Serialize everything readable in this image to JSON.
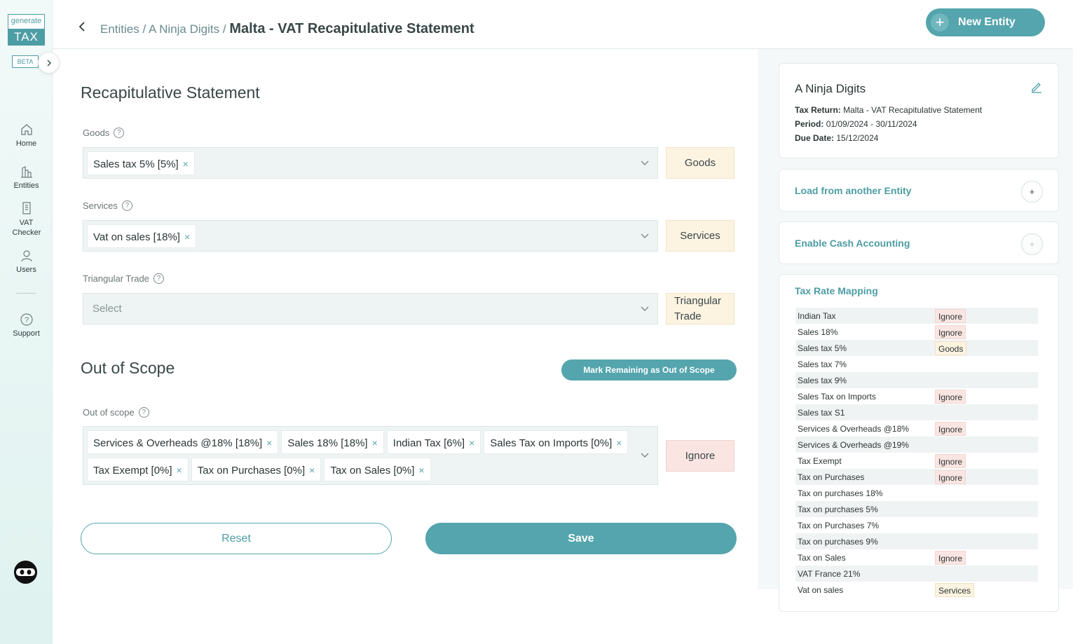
{
  "logo": {
    "top": "generate",
    "bottom": "TAX",
    "beta": "BETA"
  },
  "nav": [
    {
      "label": "Home",
      "icon": "home-icon"
    },
    {
      "label": "Entities",
      "icon": "building-icon"
    },
    {
      "label": "VAT Checker",
      "icon": "document-icon"
    },
    {
      "label": "Users",
      "icon": "user-icon"
    },
    {
      "label": "Support",
      "icon": "help-circle-icon"
    }
  ],
  "header": {
    "crumb1": "Entities",
    "sep": "/",
    "crumb2": "A Ninja Digits",
    "current": "Malta - VAT Recapitulative Statement",
    "new_entity": "New Entity"
  },
  "main": {
    "title": "Recapitulative Statement",
    "goods": {
      "label": "Goods",
      "chips": [
        "Sales tax 5% [5%]"
      ],
      "tag": "Goods"
    },
    "services": {
      "label": "Services",
      "chips": [
        "Vat on sales [18%]"
      ],
      "tag": "Services"
    },
    "triangular": {
      "label": "Triangular Trade",
      "placeholder": "Select",
      "tag": "Triangular Trade"
    },
    "oos_title": "Out of Scope",
    "mark_button": "Mark Remaining as Out of Scope",
    "oos": {
      "label": "Out of scope",
      "chips_row1": [
        "Services & Overheads @18% [18%]",
        "Sales 18% [18%]",
        "Indian Tax [6%]",
        "Sales Tax on Imports [0%]"
      ],
      "chips_row2": [
        "Tax Exempt [0%]",
        "Tax on Purchases [0%]",
        "Tax on Sales [0%]"
      ],
      "tag": "Ignore"
    },
    "reset": "Reset",
    "save": "Save"
  },
  "entity": {
    "name": "A Ninja Digits",
    "tax_return_label": "Tax Return:",
    "tax_return": "Malta - VAT Recapitulative Statement",
    "period_label": "Period:",
    "period": "01/09/2024 - 30/11/2024",
    "due_label": "Due Date:",
    "due": "15/12/2024"
  },
  "load_from": {
    "title": "Load from another Entity",
    "btn": "+"
  },
  "cash": {
    "title": "Enable Cash Accounting",
    "btn": "+"
  },
  "mapping": {
    "title": "Tax Rate Mapping",
    "rows": [
      {
        "name": "Indian Tax",
        "value": "Ignore"
      },
      {
        "name": "Sales 18%",
        "value": "Ignore"
      },
      {
        "name": "Sales tax 5%",
        "value": "Goods"
      },
      {
        "name": "Sales tax 7%",
        "value": ""
      },
      {
        "name": "Sales tax 9%",
        "value": ""
      },
      {
        "name": "Sales Tax on Imports",
        "value": "Ignore"
      },
      {
        "name": "Sales tax S1",
        "value": ""
      },
      {
        "name": "Services & Overheads @18%",
        "value": "Ignore"
      },
      {
        "name": "Services & Overheads @19%",
        "value": ""
      },
      {
        "name": "Tax Exempt",
        "value": "Ignore"
      },
      {
        "name": "Tax on Purchases",
        "value": "Ignore"
      },
      {
        "name": "Tax on purchases 18%",
        "value": ""
      },
      {
        "name": "Tax on purchases 5%",
        "value": ""
      },
      {
        "name": "Tax on Purchases 7%",
        "value": ""
      },
      {
        "name": "Tax on purchases 9%",
        "value": ""
      },
      {
        "name": "Tax on Sales",
        "value": "Ignore"
      },
      {
        "name": "VAT France 21%",
        "value": ""
      },
      {
        "name": "Vat on sales",
        "value": "Services"
      }
    ]
  },
  "colors": {
    "accent": "#54a5ad",
    "goods_tag": "#fdf3e1",
    "ignore_tag": "#fbe5e2"
  }
}
